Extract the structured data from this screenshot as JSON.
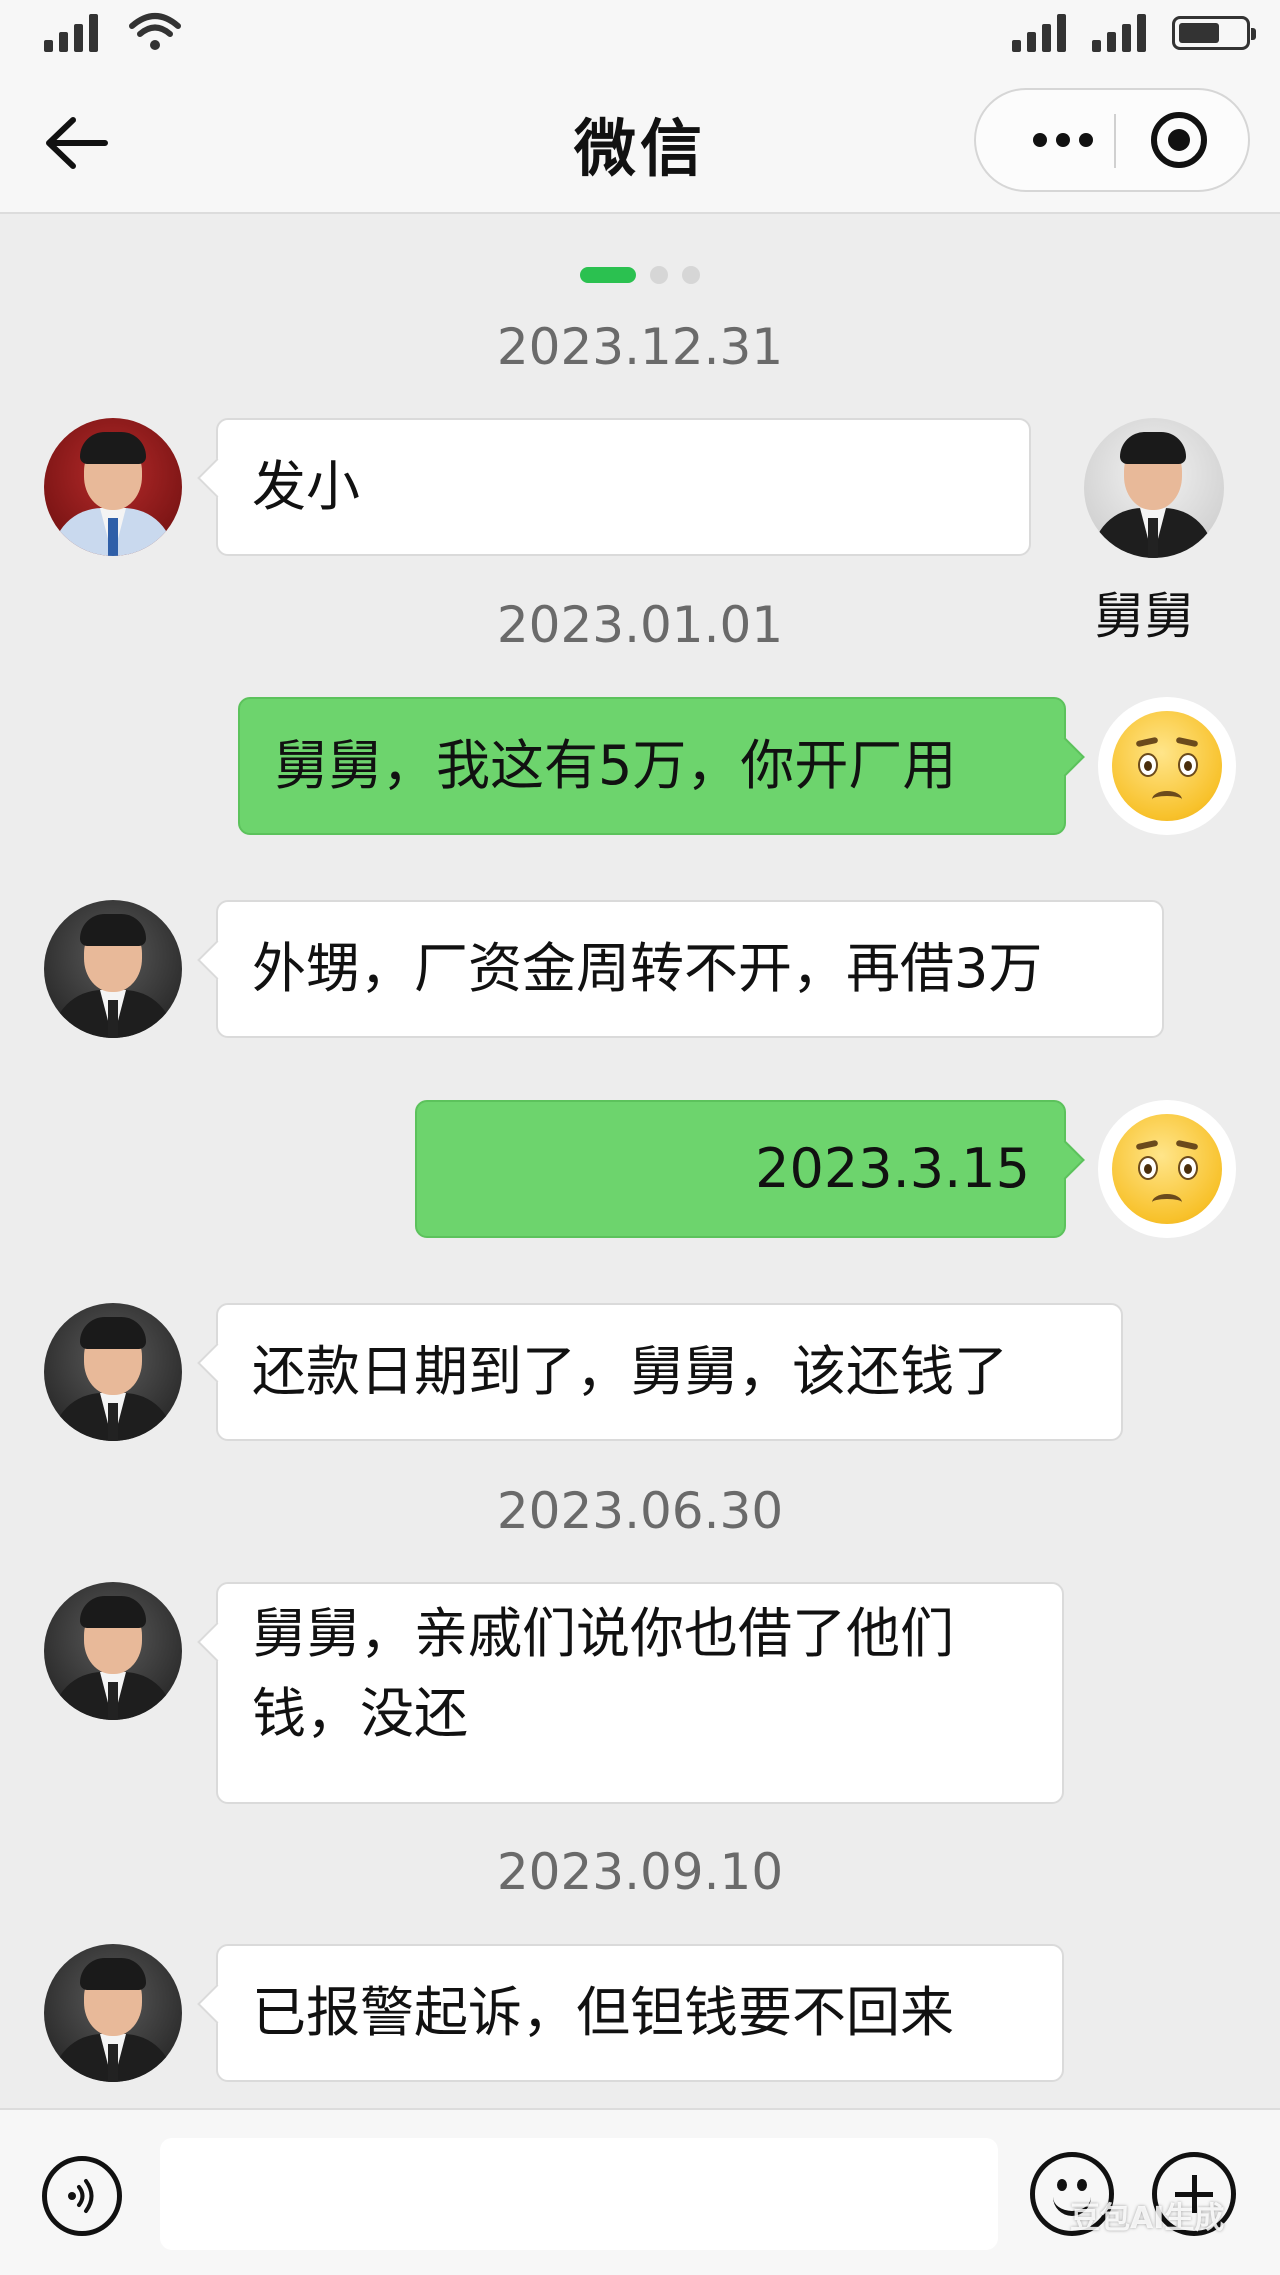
{
  "header": {
    "title": "微信"
  },
  "timestamps": [
    "2023.12.31",
    "2023.01.01",
    "2023.06.30",
    "2023.09.10"
  ],
  "contact": {
    "name": "舅舅"
  },
  "messages": [
    {
      "side": "left",
      "text": "发小"
    },
    {
      "side": "right",
      "text": "舅舅，我这有5万，你开厂用"
    },
    {
      "side": "left",
      "text": "外甥，厂资金周转不开，再借3万"
    },
    {
      "side": "right",
      "text": "2023.3.15"
    },
    {
      "side": "left",
      "text": "还款日期到了，舅舅，该还钱了"
    },
    {
      "side": "left",
      "text": "舅舅，亲戚们说你也借了他们钱，没还"
    },
    {
      "side": "left",
      "text": "已报警起诉，但钽钱要不回来"
    }
  ],
  "watermark": "豆包AI生成",
  "colors": {
    "bubble_green": "#6dd46d",
    "pager_active": "#2bc150",
    "background": "#ededed"
  },
  "icons": [
    "signal-icon",
    "wifi-icon",
    "battery-icon",
    "back-arrow-icon",
    "more-icon",
    "record-icon",
    "voice-icon",
    "emoji-icon",
    "plus-icon"
  ]
}
